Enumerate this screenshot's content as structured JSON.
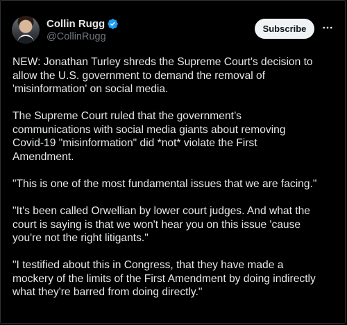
{
  "author": {
    "display_name": "Collin Rugg",
    "handle": "@CollinRugg",
    "verified_icon": "verified-badge-icon",
    "verified_color": "#1d9bf0"
  },
  "actions": {
    "subscribe_label": "Subscribe",
    "more_icon": "more-horizontal-icon"
  },
  "tweet": {
    "paragraphs": [
      "NEW: Jonathan Turley shreds the Supreme Court's decision to\nallow the U.S. government to demand the removal of\n'misinformation' on social media.",
      "The Supreme Court ruled that the government’s\ncommunications with social media giants about removing\nCovid-19 \"misinformation\" did *not* violate the First\nAmendment.",
      "\"This is one of the most fundamental issues that we are facing.\"",
      "\"It's been called Orwellian by lower court judges. And what the\ncourt is saying is that we won't hear you on this issue 'cause\nyou're not the right litigants.\"",
      "\"I testified about this in Congress, that they have made a\nmockery of the limits of the First Amendment by doing indirectly\nwhat they're barred from doing directly.\""
    ]
  },
  "colors": {
    "background": "#000000",
    "text": "#e7e9ea",
    "secondary_text": "#71767b",
    "button_bg": "#eff3f4",
    "button_text": "#0f1419"
  }
}
